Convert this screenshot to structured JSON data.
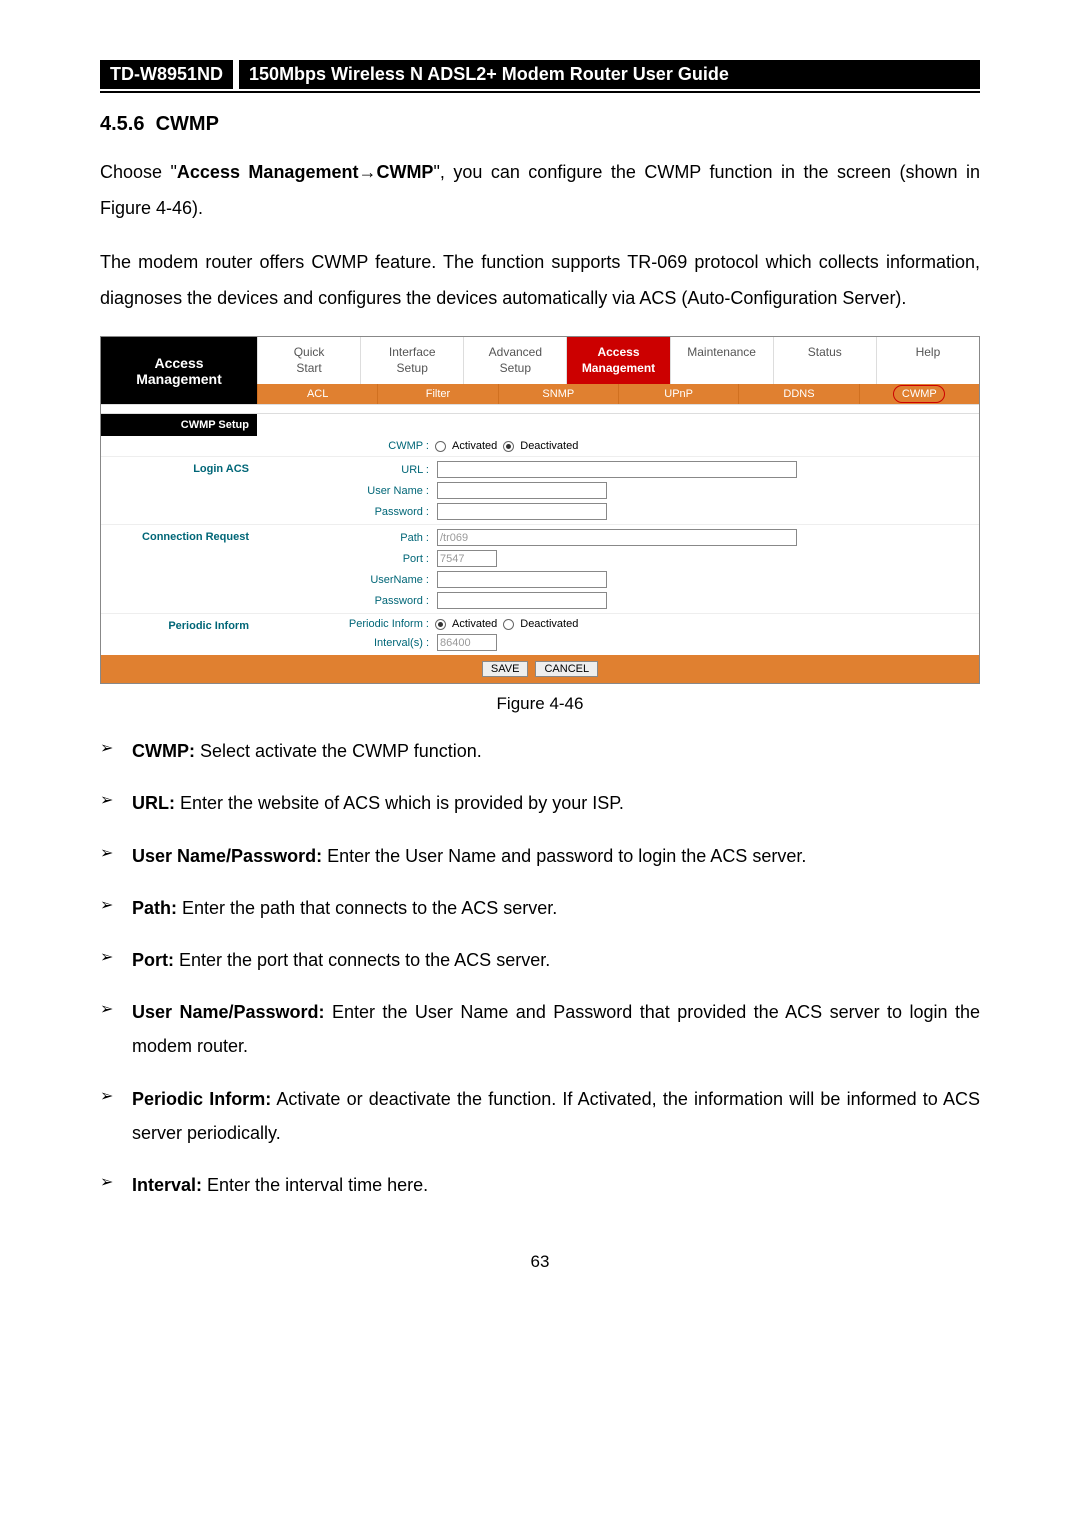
{
  "header": {
    "model": "TD-W8951ND",
    "title": "150Mbps Wireless N ADSL2+ Modem Router User Guide"
  },
  "section": {
    "number": "4.5.6",
    "title": "CWMP"
  },
  "para1_pre": "Choose \"",
  "para1_bold": "Access Management→CWMP",
  "para1_post": "\", you can configure the CWMP function in the screen (shown in Figure 4-46).",
  "para2": "The modem router offers CWMP feature. The function supports TR-069 protocol which collects information, diagnoses the devices and configures the devices automatically via ACS (Auto-Configuration Server).",
  "nav": {
    "sidebar_line1": "Access",
    "sidebar_line2": "Management",
    "tabs": {
      "t0": "Quick\nStart",
      "t1": "Interface\nSetup",
      "t2": "Advanced\nSetup",
      "t3": "Access\nManagement",
      "t4": "Maintenance",
      "t5": "Status",
      "t6": "Help"
    },
    "subtabs": {
      "s0": "ACL",
      "s1": "Filter",
      "s2": "SNMP",
      "s3": "UPnP",
      "s4": "DDNS",
      "s5": "CWMP"
    }
  },
  "form": {
    "cwmp_setup": "CWMP Setup",
    "cwmp_label": "CWMP :",
    "activated": "Activated",
    "deactivated": "Deactivated",
    "login_acs": "Login ACS",
    "url": "URL :",
    "username": "User Name :",
    "password": "Password :",
    "conn_req": "Connection Request",
    "path_label": "Path :",
    "path_val": "/tr069",
    "port_label": "Port :",
    "port_val": "7547",
    "cr_username_label": "UserName :",
    "cr_password_label": "Password :",
    "periodic": "Periodic Inform",
    "periodic_label": "Periodic Inform :",
    "interval_label": "Interval(s) :",
    "interval_val": "86400",
    "save": "SAVE",
    "cancel": "CANCEL"
  },
  "figure": "Figure 4-46",
  "bullets": {
    "b0_bold": "CWMP:",
    "b0_text": " Select activate the CWMP function.",
    "b1_bold": "URL:",
    "b1_text": " Enter the website of ACS which is provided by your ISP.",
    "b2_bold": "User Name/Password:",
    "b2_text": " Enter the User Name and password to login the ACS server.",
    "b3_bold": "Path:",
    "b3_text": " Enter the path that connects to the ACS server.",
    "b4_bold": "Port:",
    "b4_text": " Enter the port that connects to the ACS server.",
    "b5_bold": "User Name/Password:",
    "b5_text": " Enter the User Name and Password that provided the ACS server to login the modem router.",
    "b6_bold": "Periodic Inform:",
    "b6_text": " Activate or deactivate the function. If Activated, the information will be informed to ACS server periodically.",
    "b7_bold": "Interval:",
    "b7_text": " Enter the interval time here."
  },
  "page_number": "63"
}
